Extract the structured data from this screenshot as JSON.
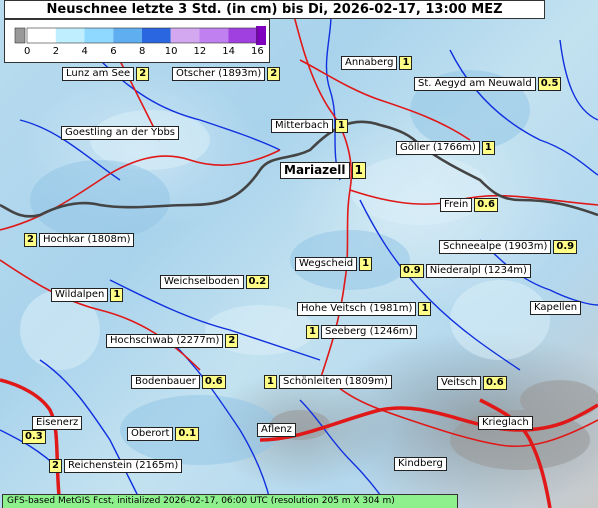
{
  "title": "Neuschnee letzte 3 Std. (in cm) bis Di, 2026-02-17, 13:00 MEZ",
  "legend": {
    "ticks": [
      "0",
      "2",
      "4",
      "6",
      "8",
      "10",
      "12",
      "14",
      "16"
    ],
    "colors": [
      "#ffffff",
      "#bfefff",
      "#8fd8ff",
      "#5eaef0",
      "#2a66e0",
      "#d4a8f0",
      "#c080f0",
      "#a040e0",
      "#8000c0"
    ],
    "below_color": "#999999"
  },
  "locations": [
    {
      "name": "Annaberg",
      "value": "1"
    },
    {
      "name": "Lunz am See",
      "value": "2"
    },
    {
      "name": "Ötscher (1893m)",
      "value": "2"
    },
    {
      "name": "St. Aegyd am Neuwald",
      "value": "0.5"
    },
    {
      "name": "Goestling an der Ybbs",
      "value": ""
    },
    {
      "name": "Mitterbach",
      "value": "1"
    },
    {
      "name": "Göller (1766m)",
      "value": "1"
    },
    {
      "name": "Mariazell",
      "value": "1"
    },
    {
      "name": "Frein",
      "value": "0.6"
    },
    {
      "name": "Hochkar (1808m)",
      "value": "2"
    },
    {
      "name": "Schneealpe (1903m)",
      "value": "0.9"
    },
    {
      "name": "Wegscheid",
      "value": "1"
    },
    {
      "name": "Niederalpl (1234m)",
      "value": "0.9"
    },
    {
      "name": "Weichselboden",
      "value": "0.2"
    },
    {
      "name": "Wildalpen",
      "value": "1"
    },
    {
      "name": "Hohe Veitsch (1981m)",
      "value": "1"
    },
    {
      "name": "Kapellen",
      "value": ""
    },
    {
      "name": "Seeberg (1246m)",
      "value": "1"
    },
    {
      "name": "Hochschwab (2277m)",
      "value": "2"
    },
    {
      "name": "Bodenbauer",
      "value": "0.6"
    },
    {
      "name": "Schönleiten (1809m)",
      "value": "1"
    },
    {
      "name": "Veitsch",
      "value": "0.6"
    },
    {
      "name": "Eisenerz",
      "value": "0.3"
    },
    {
      "name": "Oberort",
      "value": "0.1"
    },
    {
      "name": "Aflenz",
      "value": ""
    },
    {
      "name": "Krieglach",
      "value": ""
    },
    {
      "name": "Reichenstein (2165m)",
      "value": "2"
    },
    {
      "name": "Kindberg",
      "value": ""
    }
  ],
  "footer": "GFS-based MetGIS Fcst, initialized 2026-02-17, 06:00 UTC  (resolution 205 m X 304 m)"
}
